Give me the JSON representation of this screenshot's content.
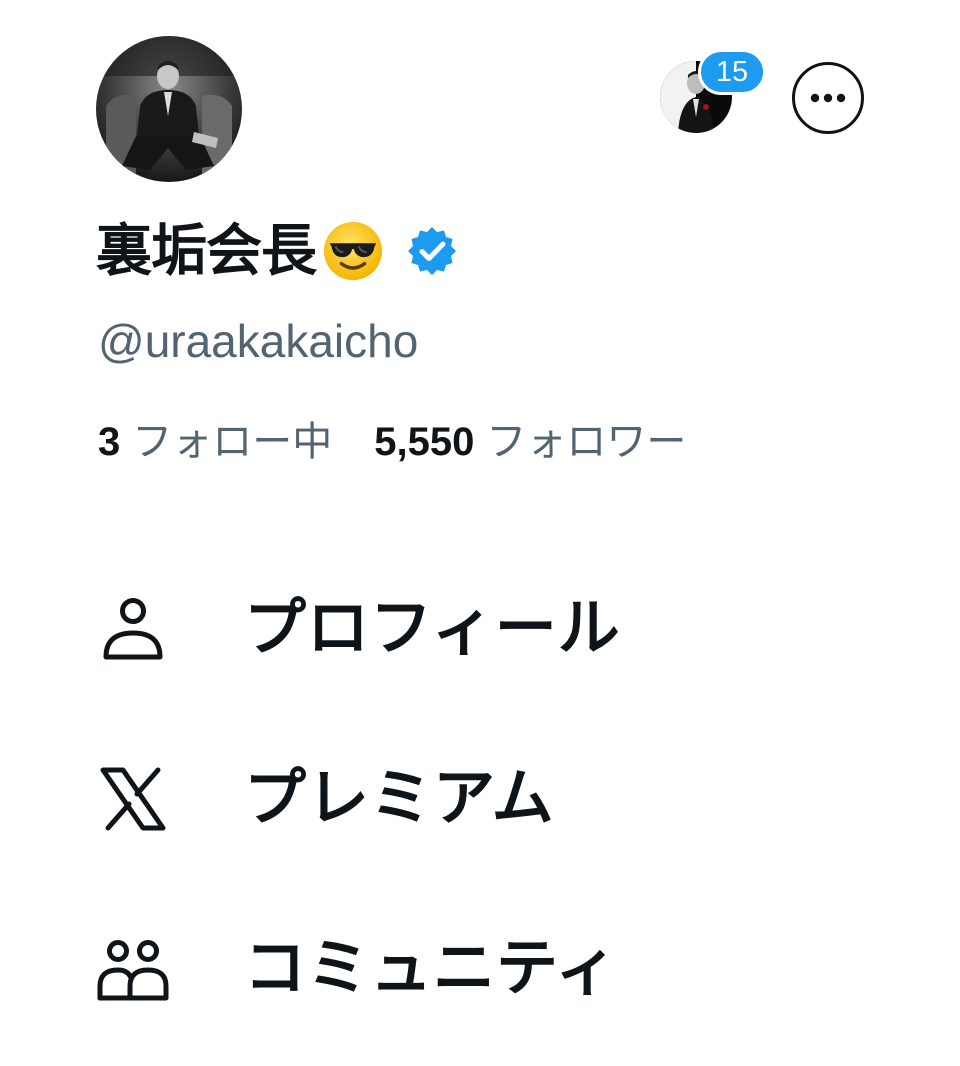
{
  "profile": {
    "display_name": "裏垢会長",
    "name_emoji": "smiling-face-with-sunglasses",
    "verified": true,
    "handle": "@uraakakaicho",
    "avatar_alt": "avatar-photo"
  },
  "account_switcher": {
    "badge_count": "15"
  },
  "stats": {
    "following_count": "3",
    "following_label": "フォロー中",
    "followers_count": "5,550",
    "followers_label": "フォロワー"
  },
  "menu": [
    {
      "label": "プロフィール",
      "icon": "person-icon"
    },
    {
      "label": "プレミアム",
      "icon": "x-logo-icon"
    },
    {
      "label": "コミュニティ",
      "icon": "people-icon"
    }
  ],
  "colors": {
    "text_primary": "#0f1419",
    "text_secondary": "#536471",
    "accent": "#1d9bf0"
  }
}
